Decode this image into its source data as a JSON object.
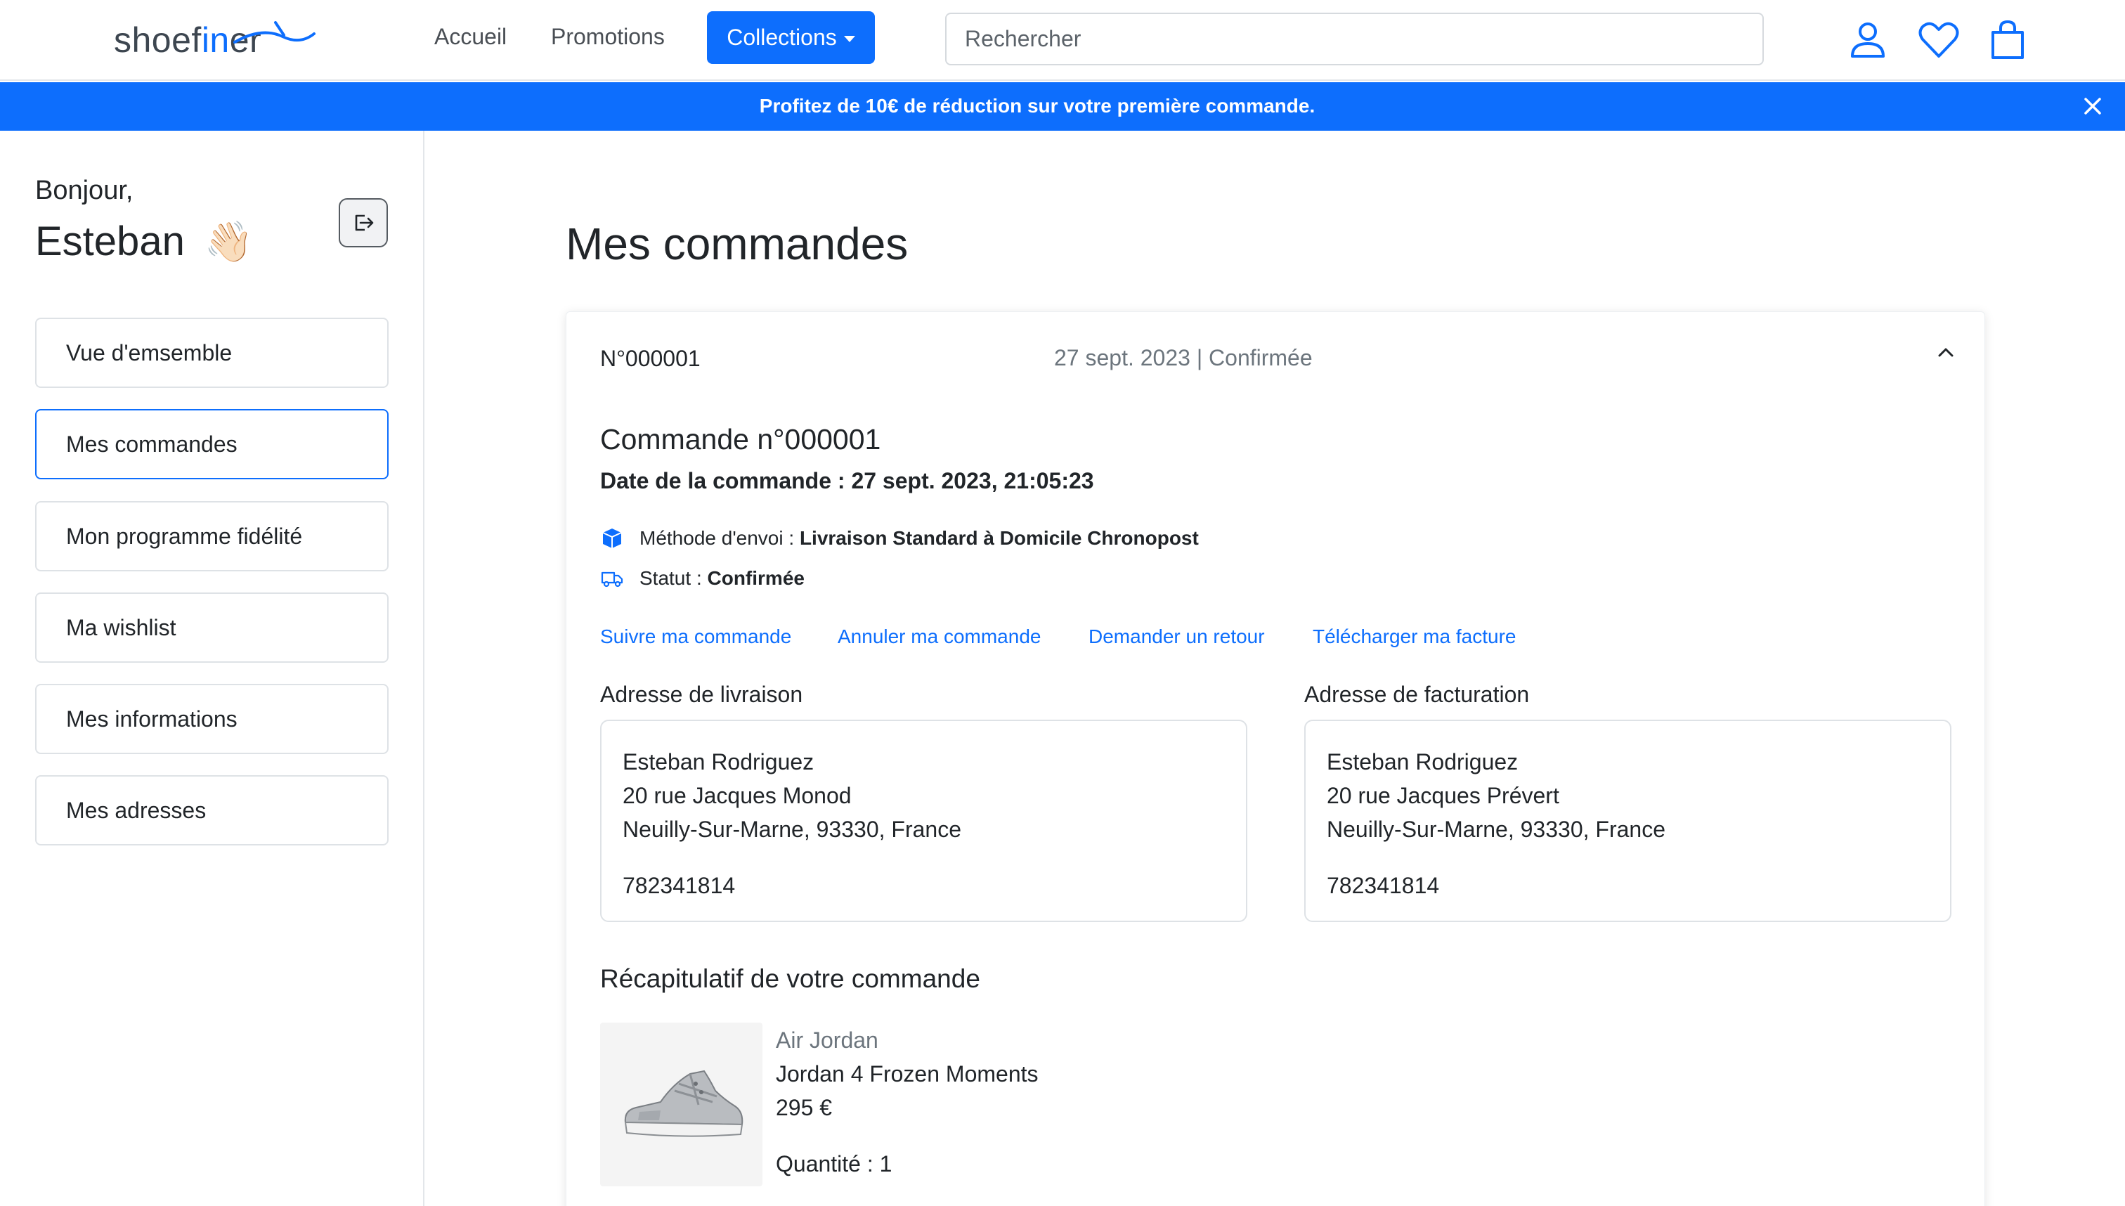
{
  "header": {
    "logo": {
      "part1": "shoef",
      "part2": "in",
      "part3": "er"
    },
    "nav": {
      "accueil": "Accueil",
      "promotions": "Promotions",
      "collections": "Collections"
    },
    "search_placeholder": "Rechercher",
    "icons": [
      "user-icon",
      "heart-icon",
      "bag-icon"
    ]
  },
  "banner": {
    "text": "Profitez de 10€ de réduction sur votre première commande.",
    "close_icon": "close-icon"
  },
  "sidebar": {
    "greeting": "Bonjour,",
    "name": "Esteban",
    "wave_emoji": "👋🏻",
    "logout_icon": "logout-icon",
    "items": [
      {
        "label": "Vue d'emsemble",
        "active": false
      },
      {
        "label": "Mes commandes",
        "active": true
      },
      {
        "label": "Mon programme fidélité",
        "active": false
      },
      {
        "label": "Ma wishlist",
        "active": false
      },
      {
        "label": "Mes informations",
        "active": false
      },
      {
        "label": "Mes adresses",
        "active": false
      }
    ]
  },
  "main": {
    "title": "Mes commandes",
    "order": {
      "number": "N°000001",
      "meta": "27 sept. 2023 | Confirmée",
      "title": "Commande n°000001",
      "date": "Date de la commande : 27 sept. 2023, 21:05:23",
      "shipping_label": "Méthode d'envoi :",
      "shipping_value": "Livraison Standard à Domicile Chronopost",
      "status_label": "Statut :",
      "status_value": "Confirmée",
      "actions": [
        "Suivre ma commande",
        "Annuler ma commande",
        "Demander un retour",
        "Télécharger ma facture"
      ],
      "delivery": {
        "label": "Adresse de livraison",
        "name": "Esteban Rodriguez",
        "street": "20 rue Jacques Monod",
        "city": "Neuilly-Sur-Marne, 93330, France",
        "phone": "782341814"
      },
      "billing": {
        "label": "Adresse de facturation",
        "name": "Esteban Rodriguez",
        "street": "20 rue Jacques Prévert",
        "city": "Neuilly-Sur-Marne, 93330, France",
        "phone": "782341814"
      },
      "recap_title": "Récapitulatif de votre commande",
      "product": {
        "brand": "Air Jordan",
        "name": "Jordan 4 Frozen Moments",
        "price": "295 €",
        "quantity": "Quantité : 1"
      }
    }
  },
  "colors": {
    "accent": "#0d6efd",
    "muted": "#6c757d",
    "border": "#dee2e6"
  }
}
